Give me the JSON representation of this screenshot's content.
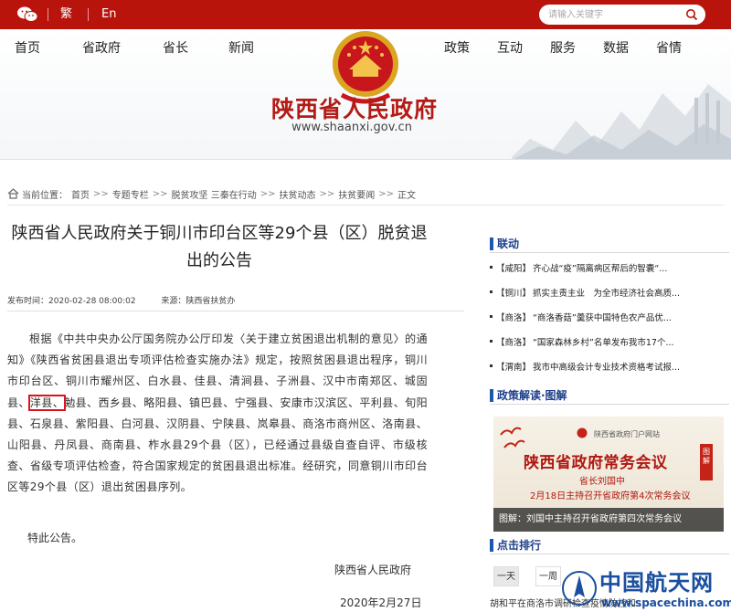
{
  "topbar": {
    "trad_label": "繁",
    "en_label": "En",
    "search_placeholder": "请输入关键字"
  },
  "nav": {
    "left": [
      "首页",
      "省政府",
      "省长",
      "新闻"
    ],
    "right": [
      "政策",
      "互动",
      "服务",
      "数据",
      "省情"
    ]
  },
  "site": {
    "title": "陕西省人民政府",
    "domain": "www.shaanxi.gov.cn"
  },
  "breadcrumb": {
    "prefix": "当前位置：",
    "items": [
      "首页",
      "专题专栏",
      "脱贫攻坚 三秦在行动",
      "扶贫动态",
      "扶贫要闻",
      "正文"
    ],
    "separator": ">>"
  },
  "article": {
    "title": "陕西省人民政府关于铜川市印台区等29个县（区）脱贫退出的公告",
    "published_label": "发布时间：",
    "published_value": "2020-02-28 08:00:02",
    "source_label": "来源：",
    "source_value": "陕西省扶贫办",
    "body_before": "根据《中共中央办公厅国务院办公厅印发〈关于建立贫困退出机制的意见〉的通知》《陕西省贫困县退出专项评估检查实施办法》规定，按照贫困县退出程序，铜川市印台区、铜川市耀州区、白水县、佳县、清涧县、子洲县、汉中市南郑区、城固县、",
    "body_highlight": "洋县、",
    "body_after": "勉县、西乡县、略阳县、镇巴县、宁强县、安康市汉滨区、平利县、旬阳县、石泉县、紫阳县、白河县、汉阴县、宁陕县、岚皋县、商洛市商州区、洛南县、山阳县、丹凤县、商南县、柞水县29个县（区），已经通过县级自查自评、市级核查、省级专项评估检查，符合国家规定的贫困县退出标准。经研究，同意铜川市印台区等29个县（区）退出贫困县序列。",
    "closing": "特此公告。",
    "signature": "陕西省人民政府",
    "date": "2020年2月27日"
  },
  "sidebar": {
    "linkage_title": "联动",
    "linkage_items": [
      {
        "tag": "【咸阳】",
        "text": "齐心战“疫”隔离病区帮后的智囊“..."
      },
      {
        "tag": "【铜川】",
        "text": "抓实主责主业　为全市经济社会高质..."
      },
      {
        "tag": "【商洛】",
        "text": "“商洛香菇”羹获中国特色农产品优..."
      },
      {
        "tag": "【商洛】",
        "text": "“国家森林乡村”名单发布我市17个..."
      },
      {
        "tag": "【渭南】",
        "text": "我市中高级会计专业技术资格考试报..."
      }
    ],
    "policy_title": "政策解读·图解",
    "banner": {
      "logo_text": "陕西省政府门户网站",
      "title": "陕西省政府常务会议",
      "stamp": "图解",
      "line1": "省长刘国中",
      "line2": "2月18日主持召开省政府第4次常务会议",
      "caption": "图解：刘国中主持召开省政府第四次常务会议"
    },
    "ranking_title": "点击排行",
    "ranking_tabs": [
      "一天",
      "一周"
    ],
    "bottom_snippet": "胡和平在商洛市调研检查疫情防控和..."
  },
  "watermark": {
    "name": "中国航天网",
    "url": "www.spacechina.com"
  },
  "colors": {
    "topbar": "#b8140c",
    "title_red": "#b31b16",
    "sidebar_blue": "#1d3f8a",
    "highlight_box": "#d9141e"
  }
}
